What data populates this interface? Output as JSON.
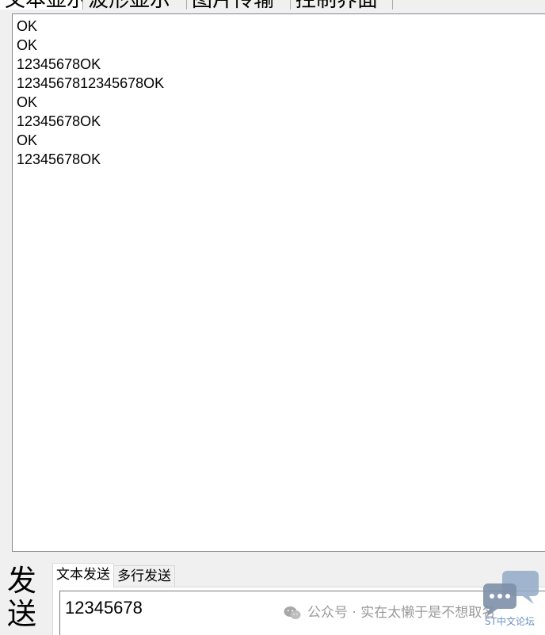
{
  "top_tabs": [
    {
      "label": "文本显示"
    },
    {
      "label": "波形显示"
    },
    {
      "label": "图片传输"
    },
    {
      "label": "控制界面"
    }
  ],
  "receive": {
    "lines": [
      "OK",
      "OK",
      "12345678OK",
      "1234567812345678OK",
      "OK",
      "12345678OK",
      "OK",
      "12345678OK"
    ]
  },
  "send": {
    "label_line1": "发",
    "label_line2": "送",
    "tabs": [
      {
        "label": "文本发送"
      },
      {
        "label": "多行发送"
      }
    ],
    "input_value": "12345678"
  },
  "watermark": {
    "wechat_text": "公众号 · 实在太懒于是不想取名",
    "st_text": "ST中文论坛",
    "icon": "wechat-icon",
    "logo": "chat-bubble-logo"
  },
  "colors": {
    "border": "#828790",
    "watermark_gray": "#9a9a9a",
    "logo_blue": "#6a90c4"
  }
}
